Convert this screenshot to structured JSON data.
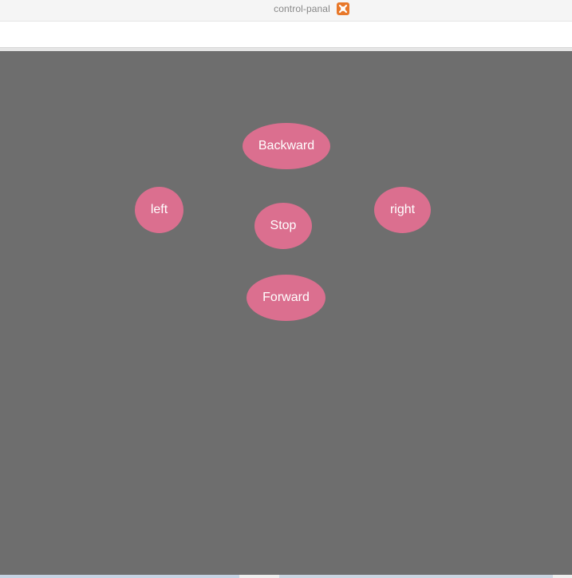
{
  "window": {
    "title": "control-panal",
    "app_icon": "xampp-icon",
    "app_icon_color": "#e8782a"
  },
  "address_bar": {
    "value": "",
    "placeholder": ""
  },
  "panel": {
    "background": "#6e6e6e",
    "button_color": "#db6f8f",
    "buttons": {
      "backward": "Backward",
      "left": "left",
      "stop": "Stop",
      "right": "right",
      "forward": "Forward"
    }
  }
}
